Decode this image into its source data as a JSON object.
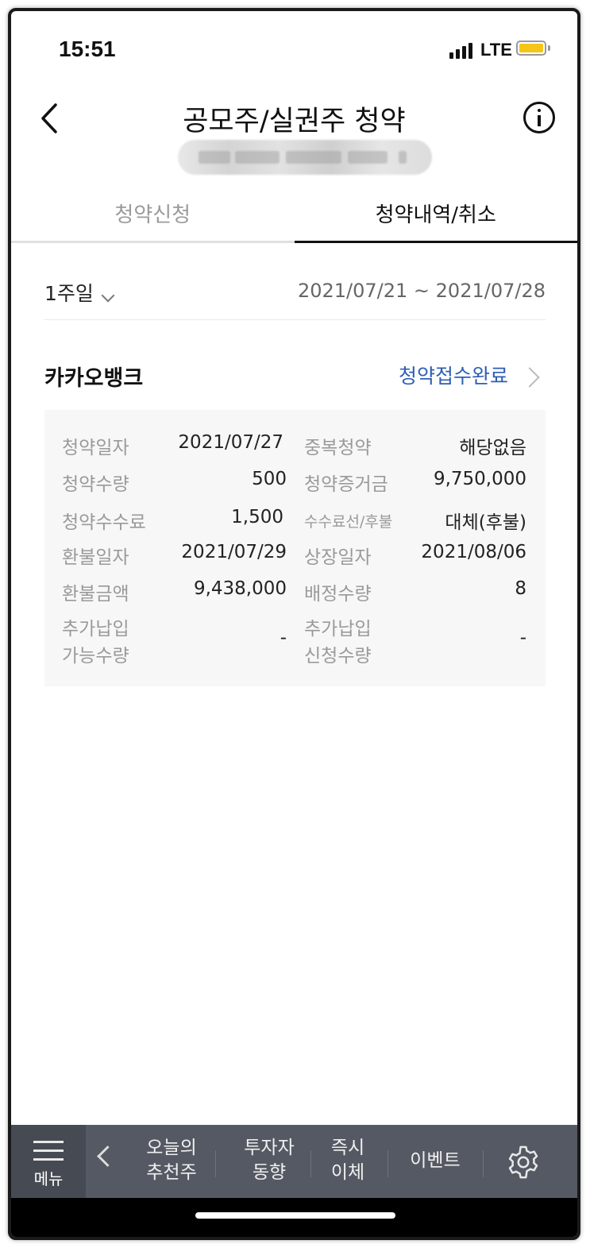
{
  "status_bar": {
    "time": "15:51",
    "network": "LTE",
    "colors": {
      "battery": "#f5c518"
    }
  },
  "header": {
    "title": "공모주/실권주 청약",
    "back_icon": "chevron-left-icon",
    "info_icon": "info-circle-icon"
  },
  "tabs": [
    {
      "label": "청약신청",
      "active": false
    },
    {
      "label": "청약내역/취소",
      "active": true
    }
  ],
  "filter": {
    "period": "1주일",
    "date_range": "2021/07/21 ~ 2021/07/28"
  },
  "card": {
    "bank": "카카오뱅크",
    "status": "청약접수완료",
    "status_color": "#2d5fb3",
    "rows": [
      {
        "label_left": "청약일자",
        "value_left": "2021/07/27",
        "label_right": "중복청약",
        "value_right": "해당없음"
      },
      {
        "label_left": "청약수량",
        "value_left": "500",
        "label_right": "청약증거금",
        "value_right": "9,750,000"
      },
      {
        "label_left": "청약수수료",
        "value_left": "1,500",
        "label_right": "수수료선/후불",
        "value_right": "대체(후불)"
      },
      {
        "label_left": "환불일자",
        "value_left": "2021/07/29",
        "label_right": "상장일자",
        "value_right": "2021/08/06"
      },
      {
        "label_left": "환불금액",
        "value_left": "9,438,000",
        "label_right": "배정수량",
        "value_right": "8"
      },
      {
        "label_left_1": "추가납입",
        "label_left_2": "가능수량",
        "value_left": "-",
        "label_right_1": "추가납입",
        "label_right_2": "신청수량",
        "value_right": "-"
      }
    ]
  },
  "bottom_nav": {
    "menu_label": "메뉴",
    "items": [
      {
        "line1": "오늘의",
        "line2": "추천주"
      },
      {
        "line1": "투자자",
        "line2": "동향"
      },
      {
        "line1": "즉시",
        "line2": "이체"
      },
      {
        "line1": "이벤트"
      }
    ],
    "settings_icon": "gear-icon"
  }
}
